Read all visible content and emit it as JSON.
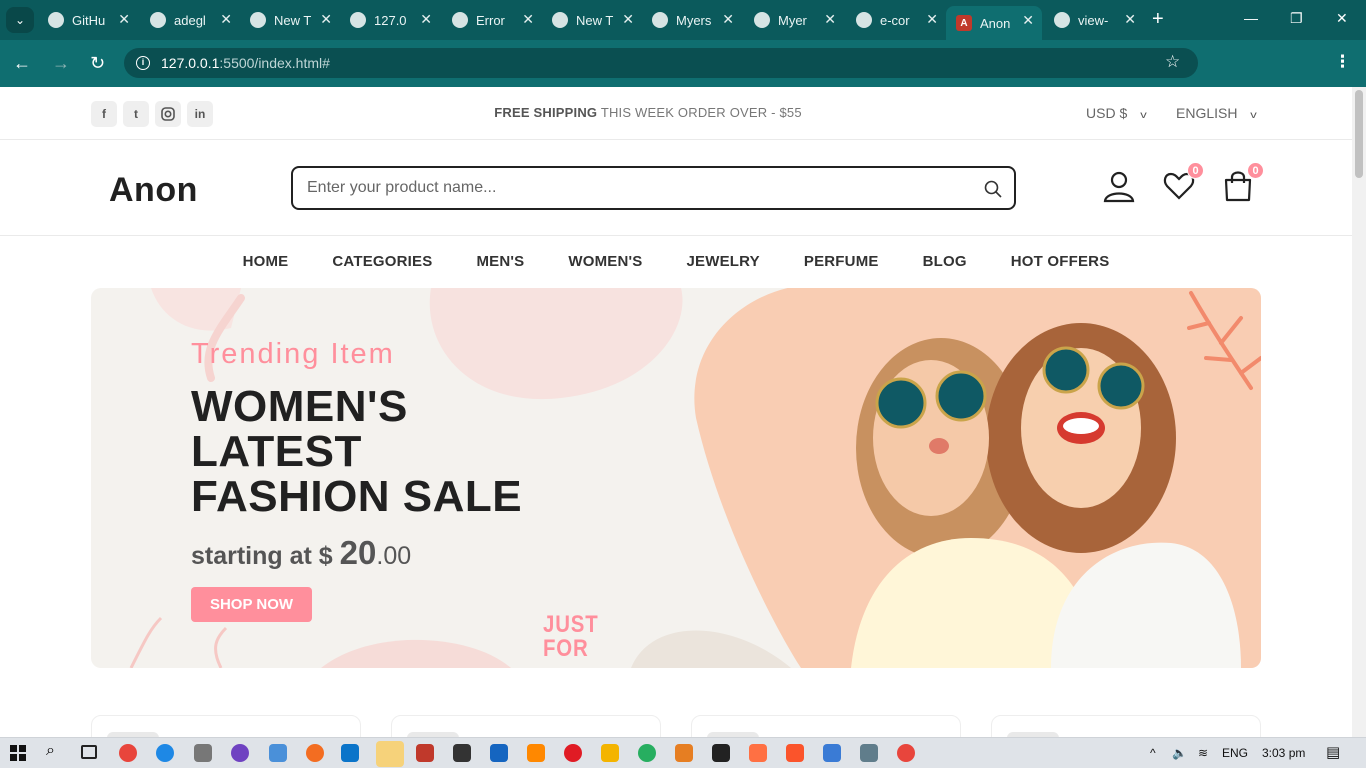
{
  "browser": {
    "tabs": [
      {
        "title": "GitHu",
        "active": false
      },
      {
        "title": "adegl",
        "active": false
      },
      {
        "title": "New T",
        "active": false
      },
      {
        "title": "127.0",
        "active": false
      },
      {
        "title": "Error",
        "active": false
      },
      {
        "title": "New T",
        "active": false
      },
      {
        "title": "Myers",
        "active": false
      },
      {
        "title": "Myer",
        "active": false
      },
      {
        "title": "e-cor",
        "active": false
      },
      {
        "title": "Anon",
        "active": true
      },
      {
        "title": "view-",
        "active": false
      }
    ],
    "url_host": "127.0.0.1",
    "url_rest": ":5500/index.html#",
    "accent": "#0f6e70"
  },
  "topbar": {
    "social": [
      "facebook-icon",
      "twitter-icon",
      "instagram-icon",
      "linkedin-icon"
    ],
    "promo_bold": "FREE SHIPPING",
    "promo_rest": "THIS WEEK ORDER OVER - $55",
    "currency": "USD $",
    "language": "ENGLISH"
  },
  "header": {
    "logo": "Anon",
    "search_placeholder": "Enter your product name...",
    "wishlist_count": "0",
    "cart_count": "0",
    "badge_color": "#ff8f9c"
  },
  "nav": {
    "items": [
      "HOME",
      "CATEGORIES",
      "MEN'S",
      "WOMEN'S",
      "JEWELRY",
      "PERFUME",
      "BLOG",
      "HOT OFFERS"
    ]
  },
  "banner": {
    "subtitle": "Trending Item",
    "title": "WOMEN'S LATEST FASHION SALE",
    "price_prefix": "starting at $",
    "price_whole": "20",
    "price_cents": ".00",
    "cta": "SHOP NOW",
    "decor_text_1": "JUST",
    "decor_text_2": "FOR"
  },
  "taskbar": {
    "language": "ENG",
    "time": "3:03 pm"
  }
}
